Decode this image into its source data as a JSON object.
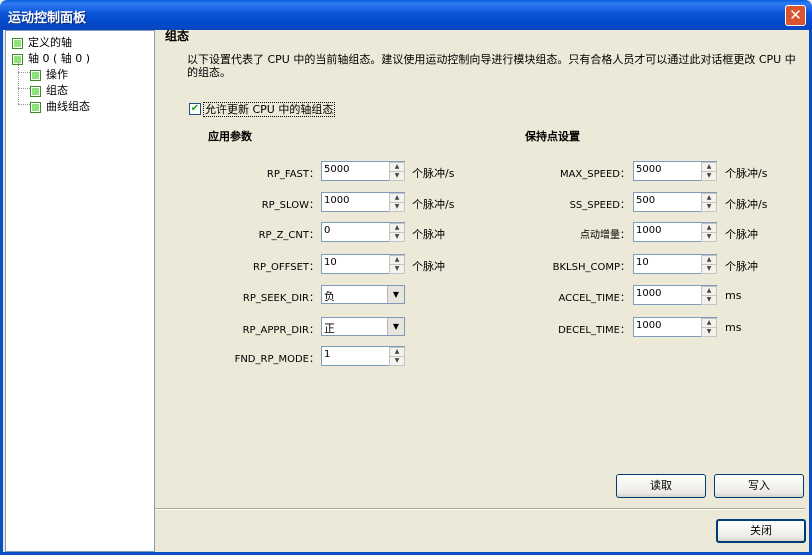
{
  "window": {
    "title": "运动控制面板",
    "close_glyph": "✕"
  },
  "tree": {
    "items": [
      {
        "label": "定义的轴"
      },
      {
        "label": "轴 0 ( 轴 0 )"
      },
      {
        "label": "操作"
      },
      {
        "label": "组态"
      },
      {
        "label": "曲线组态"
      }
    ]
  },
  "main": {
    "section_title": "组态",
    "description": "以下设置代表了 CPU 中的当前轴组态。建议使用运动控制向导进行模块组态。只有合格人员才可以通过此对话框更改 CPU 中的组态。",
    "allow_update_label": "允许更新 CPU 中的轴组态",
    "allow_update_checked": true,
    "app_params_title": "应用参数",
    "hold_params_title": "保持点设置"
  },
  "left_fields": [
    {
      "label": "RP_FAST：",
      "value": "5000",
      "unit": "个脉冲/s",
      "kind": "spin"
    },
    {
      "label": "RP_SLOW：",
      "value": "1000",
      "unit": "个脉冲/s",
      "kind": "spin"
    },
    {
      "label": "RP_Z_CNT：",
      "value": "0",
      "unit": "个脉冲",
      "kind": "spin"
    },
    {
      "label": "RP_OFFSET：",
      "value": "10",
      "unit": "个脉冲",
      "kind": "spin"
    },
    {
      "label": "RP_SEEK_DIR：",
      "value": "负",
      "unit": "",
      "kind": "combo"
    },
    {
      "label": "RP_APPR_DIR：",
      "value": "正",
      "unit": "",
      "kind": "combo"
    },
    {
      "label": "FND_RP_MODE：",
      "value": "1",
      "unit": "",
      "kind": "spin"
    }
  ],
  "right_fields": [
    {
      "label": "MAX_SPEED：",
      "value": "5000",
      "unit": "个脉冲/s"
    },
    {
      "label": "SS_SPEED：",
      "value": "500",
      "unit": "个脉冲/s"
    },
    {
      "label": "点动增量：",
      "value": "1000",
      "unit": "个脉冲"
    },
    {
      "label": "BKLSH_COMP：",
      "value": "10",
      "unit": "个脉冲"
    },
    {
      "label": "ACCEL_TIME：",
      "value": "1000",
      "unit": "ms"
    },
    {
      "label": "DECEL_TIME：",
      "value": "1000",
      "unit": "ms"
    }
  ],
  "buttons": {
    "read": "读取",
    "write": "写入",
    "close": "关闭"
  },
  "colors": {
    "titlebar": "#0a53d8",
    "background": "#ece9d8",
    "tree_box": "#8be37a"
  }
}
